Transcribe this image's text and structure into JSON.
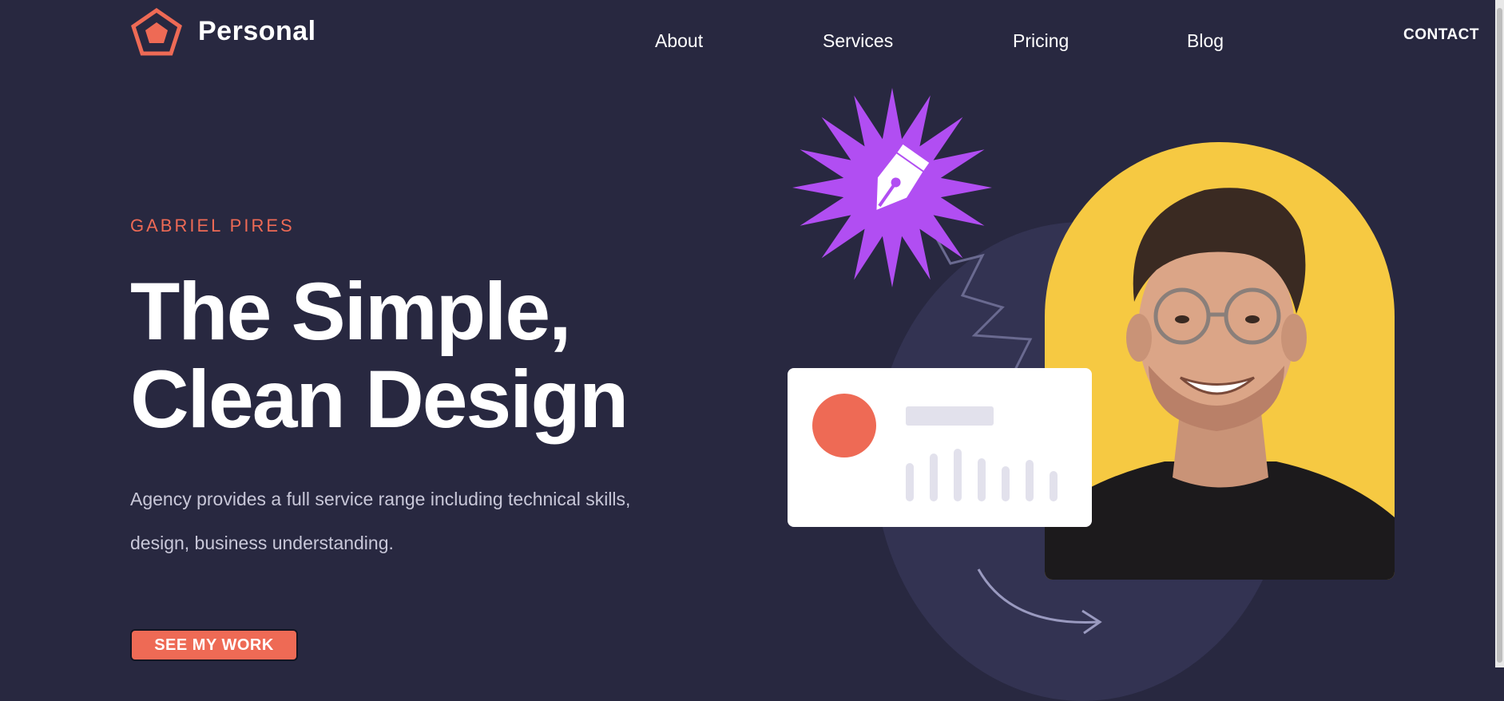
{
  "header": {
    "brand": "Personal",
    "nav": [
      "About",
      "Services",
      "Pricing",
      "Blog"
    ],
    "contact": "CONTACT"
  },
  "hero": {
    "eyebrow": "GABRIEL PIRES",
    "headline": [
      "The Simple,",
      "Clean Design"
    ],
    "description": "Agency provides a full service range including technical skills, design, business understanding.",
    "cta": "SEE MY WORK"
  },
  "illustration": {
    "badge_icon": "pen-nib-icon",
    "photo": "portrait-of-smiling-man-with-glasses"
  },
  "colors": {
    "background": "#282840",
    "accent": "#ee6a55",
    "purple": "#b14ef2",
    "yellow": "#f6c942"
  }
}
